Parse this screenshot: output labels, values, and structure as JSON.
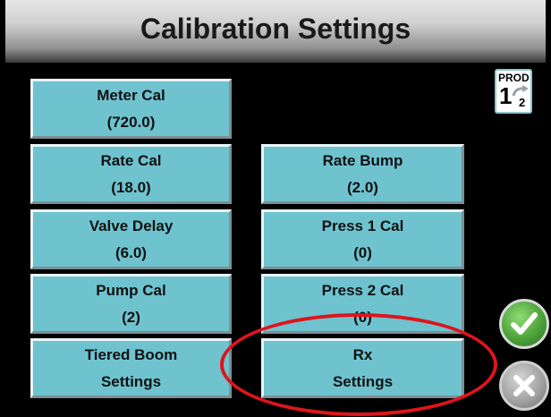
{
  "header": {
    "title": "Calibration Settings"
  },
  "buttons": {
    "meter_cal": {
      "label": "Meter Cal",
      "value": "(720.0)"
    },
    "rate_cal": {
      "label": "Rate Cal",
      "value": "(18.0)"
    },
    "rate_bump": {
      "label": "Rate Bump",
      "value": "(2.0)"
    },
    "valve_delay": {
      "label": "Valve Delay",
      "value": "(6.0)"
    },
    "press1_cal": {
      "label": "Press 1 Cal",
      "value": "(0)"
    },
    "pump_cal": {
      "label": "Pump Cal",
      "value": "(2)"
    },
    "press2_cal": {
      "label": "Press 2 Cal",
      "value": "(0)"
    },
    "tiered_boom": {
      "label": "Tiered Boom",
      "sub": "Settings"
    },
    "rx": {
      "label": "Rx",
      "sub": "Settings"
    }
  },
  "product_toggle": {
    "label": "PROD",
    "current": "1",
    "other": "2",
    "icon": "product-toggle-icon"
  },
  "actions": {
    "accept_icon": "checkmark-icon",
    "cancel_icon": "x-icon"
  },
  "colors": {
    "button_fill": "#6ec3cf",
    "accept_green": "#4da23a",
    "cancel_gray": "#9e9e9e",
    "highlight_red": "#e0141c"
  }
}
